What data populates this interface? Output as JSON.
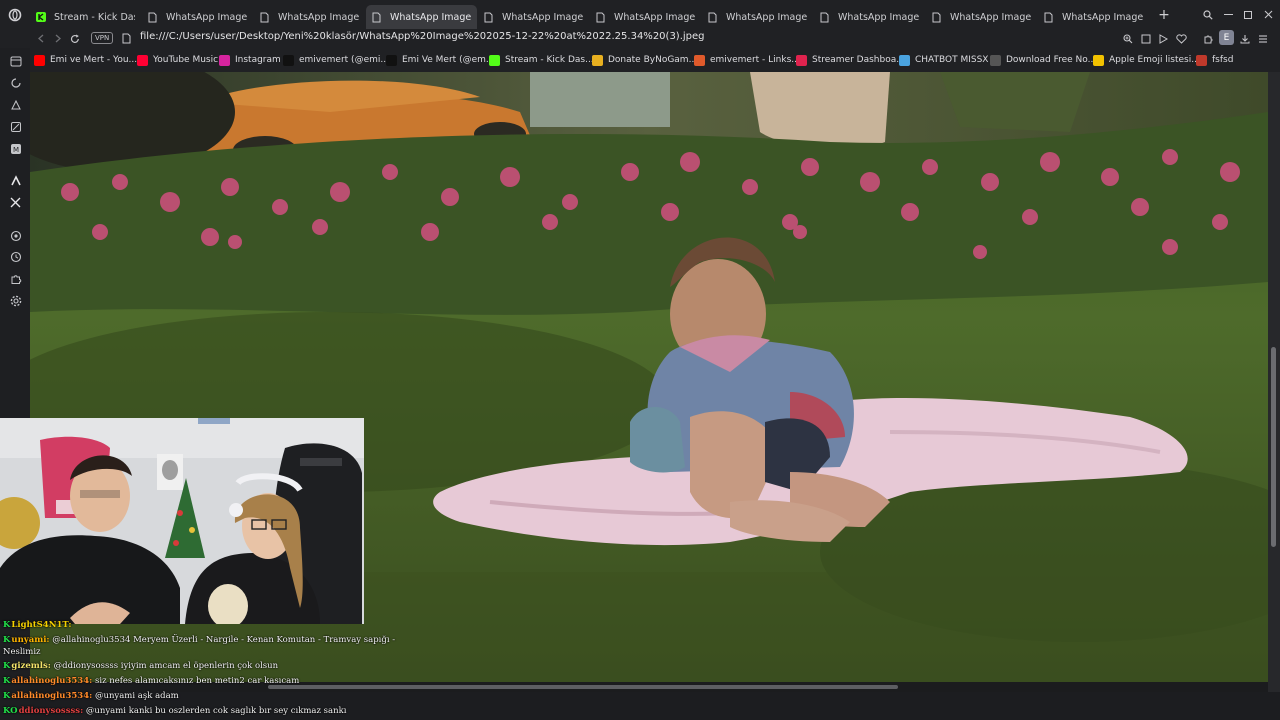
{
  "tabs": [
    {
      "label": "Stream - Kick Dashb",
      "icon": "kick-icon",
      "active": false
    },
    {
      "label": "WhatsApp Image 20",
      "icon": "document-icon",
      "active": false
    },
    {
      "label": "WhatsApp Image 20",
      "icon": "document-icon",
      "active": false
    },
    {
      "label": "WhatsApp Image 2025-",
      "icon": "document-icon",
      "active": true
    },
    {
      "label": "WhatsApp Image 20",
      "icon": "document-icon",
      "active": false
    },
    {
      "label": "WhatsApp Image 20",
      "icon": "document-icon",
      "active": false
    },
    {
      "label": "WhatsApp Image 20",
      "icon": "document-icon",
      "active": false
    },
    {
      "label": "WhatsApp Image 20",
      "icon": "document-icon",
      "active": false
    },
    {
      "label": "WhatsApp Image 20",
      "icon": "document-icon",
      "active": false
    },
    {
      "label": "WhatsApp Image 20",
      "icon": "document-icon",
      "active": false
    }
  ],
  "newtab_symbol": "+",
  "address": {
    "vpn_label": "VPN",
    "url": "file:///C:/Users/user/Desktop/Yeni%20klasör/WhatsApp%20Image%202025-12-22%20at%2022.25.34%20(3).jpeg"
  },
  "profile_initial": "E",
  "bookmarks": [
    {
      "label": "Emi ve Mert - You...",
      "icon": "youtube-icon",
      "color": "#ff0000"
    },
    {
      "label": "YouTube Music",
      "icon": "youtube-music-icon",
      "color": "#ff0033"
    },
    {
      "label": "Instagram",
      "icon": "instagram-icon",
      "color": "#d6249f"
    },
    {
      "label": "emivemert (@emi...",
      "icon": "tiktok-icon",
      "color": "#111111"
    },
    {
      "label": "Emi Ve Mert (@em...",
      "icon": "x-icon",
      "color": "#111111"
    },
    {
      "label": "Stream - Kick Das...",
      "icon": "kick-icon",
      "color": "#53fc18"
    },
    {
      "label": "Donate ByNoGam...",
      "icon": "donate-icon",
      "color": "#e8b020"
    },
    {
      "label": "emivemert - Links...",
      "icon": "linktree-icon",
      "color": "#e05a2b"
    },
    {
      "label": "Streamer Dashboa...",
      "icon": "streamer-icon",
      "color": "#e0234e"
    },
    {
      "label": "CHATBOT MISSX",
      "icon": "chatbot-icon",
      "color": "#4aa3df"
    },
    {
      "label": "Download Free No...",
      "icon": "download-icon",
      "color": "#555555"
    },
    {
      "label": "Apple Emoji listesi...",
      "icon": "emoji-icon",
      "color": "#f2c200"
    },
    {
      "label": "fsfsd",
      "icon": "globe-icon",
      "color": "#c0392b"
    }
  ],
  "chat": [
    {
      "user": "LightS4N1T:",
      "message": "",
      "user_color": "#f5d000",
      "badges": "K"
    },
    {
      "user": "unyami:",
      "message": "@allahinoglu3534 Meryem Üzerli - Nargile - Kenan Komutan - Tramvay sapığı -",
      "user_color": "#ffb400",
      "badges": "K"
    },
    {
      "user": "",
      "message": "Neslimiz",
      "user_color": "#ffffff",
      "badges": ""
    },
    {
      "user": "gizemls:",
      "message": "@ddionysossss iyiyim amcam el öpenlerin çok olsun",
      "user_color": "#f3e36a",
      "badges": "K"
    },
    {
      "user": "allahinoglu3534:",
      "message": "siz nefes alamıcaksınız ben metin2 car kasıcam",
      "user_color": "#ff8a2a",
      "badges": "K"
    },
    {
      "user": "allahinoglu3534:",
      "message": "@unyami aşk adam",
      "user_color": "#ff8a2a",
      "badges": "K"
    },
    {
      "user": "ddionysossss:",
      "message": "@unyami kanki bu oszlerden cok saglık bır sey cıkmaz sankı",
      "user_color": "#e04040",
      "badges": "KO"
    }
  ]
}
